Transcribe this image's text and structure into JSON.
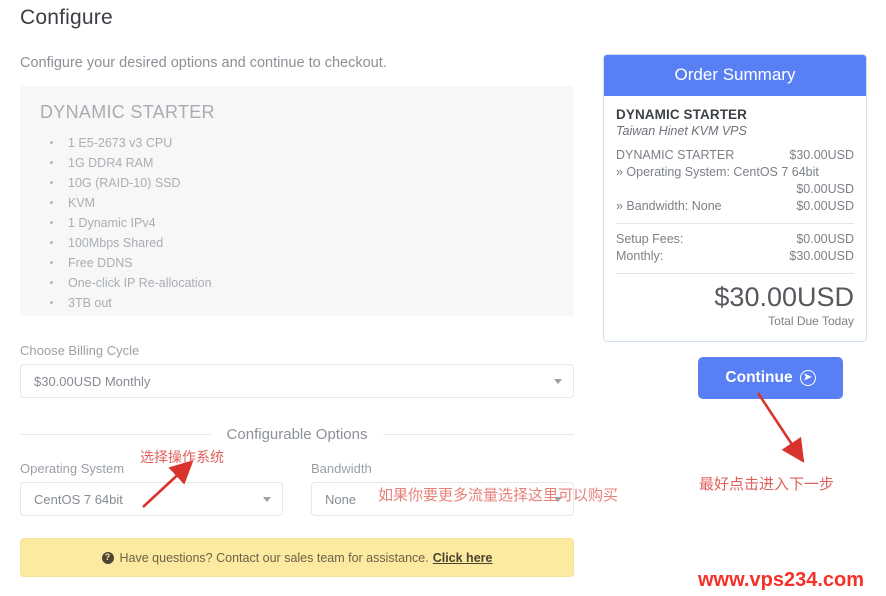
{
  "header": {
    "title": "Configure",
    "subtitle": "Configure your desired options and continue to checkout."
  },
  "product": {
    "name": "DYNAMIC STARTER",
    "features": [
      "1 E5-2673 v3 CPU",
      "1G DDR4 RAM",
      "10G (RAID-10) SSD",
      "KVM",
      "1 Dynamic IPv4",
      "100Mbps Shared",
      "Free DDNS",
      "One-click IP Re-allocation",
      "3TB out"
    ]
  },
  "billing": {
    "label": "Choose Billing Cycle",
    "selected": "$30.00USD Monthly"
  },
  "configurable": {
    "legend": "Configurable Options",
    "options": [
      {
        "label": "Operating System",
        "selected": "CentOS 7 64bit"
      },
      {
        "label": "Bandwidth",
        "selected": "None"
      }
    ]
  },
  "alert": {
    "icon": "question-circle-icon",
    "text": "Have questions? Contact our sales team for assistance.",
    "link": "Click here"
  },
  "summary": {
    "header": "Order Summary",
    "product_name": "DYNAMIC STARTER",
    "tagline": "Taiwan Hinet KVM VPS",
    "lines": [
      {
        "label": "DYNAMIC STARTER",
        "value": "$30.00USD",
        "wrapped": false
      },
      {
        "label": "» Operating System: CentOS 7 64bit",
        "value": "$0.00USD",
        "wrapped": true
      },
      {
        "label": "» Bandwidth: None",
        "value": "$0.00USD",
        "wrapped": false
      }
    ],
    "fees": [
      {
        "label": "Setup Fees:",
        "value": "$0.00USD"
      },
      {
        "label": "Monthly:",
        "value": "$30.00USD"
      }
    ],
    "total_amount": "$30.00USD",
    "total_label": "Total Due Today"
  },
  "continue": {
    "label": "Continue",
    "icon": "arrow-right-circle-icon"
  },
  "annotations": {
    "operating_system": "选择操作系统",
    "bandwidth": "如果你要更多流量选择这里可以购买",
    "continue": "最好点击进入下一步",
    "watermark": "www.vps234.com"
  },
  "colors": {
    "accent_blue": "#5880f4",
    "alert_yellow": "#fbeaa0",
    "annotation_red": "#e0605c",
    "watermark_red": "#f5312a"
  }
}
